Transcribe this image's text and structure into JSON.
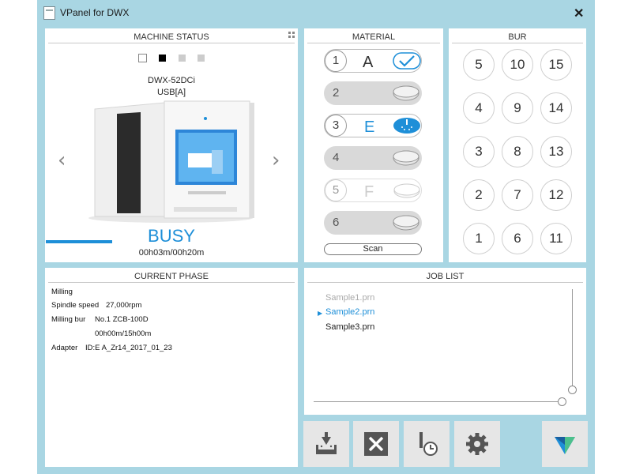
{
  "window": {
    "title": "VPanel for DWX",
    "close_glyph": "✕"
  },
  "machine_status": {
    "title": "MACHINE STATUS",
    "model": "DWX-52DCi",
    "connection": "USB[A]",
    "status": "BUSY",
    "time": "00h03m/00h20m",
    "progress": 0.15,
    "prev_arrow": "‹",
    "next_arrow": "›"
  },
  "material": {
    "title": "MATERIAL",
    "slots": [
      {
        "number": "1",
        "letter": "A",
        "state": "active"
      },
      {
        "number": "2",
        "letter": "",
        "state": "empty"
      },
      {
        "number": "3",
        "letter": "E",
        "state": "in-use"
      },
      {
        "number": "4",
        "letter": "",
        "state": "empty"
      },
      {
        "number": "5",
        "letter": "F",
        "state": "disabled"
      },
      {
        "number": "6",
        "letter": "",
        "state": "empty"
      }
    ],
    "scan_label": "Scan"
  },
  "bur": {
    "title": "BUR",
    "slots": [
      "5",
      "10",
      "15",
      "4",
      "9",
      "14",
      "3",
      "8",
      "13",
      "2",
      "7",
      "12",
      "1",
      "6",
      "11"
    ]
  },
  "current_phase": {
    "title": "CURRENT PHASE",
    "operation": "Milling",
    "spindle_label": "Spindle speed",
    "spindle_value": "27,000rpm",
    "bur_label": "Milling bur",
    "bur_value": "No.1 ZCB-100D",
    "bur_time": "00h00m/15h00m",
    "adapter_label": "Adapter",
    "adapter_value": "ID:E A_Zr14_2017_01_23"
  },
  "job_list": {
    "title": "JOB LIST",
    "jobs": [
      {
        "name": "Sample1.prn",
        "state": "done"
      },
      {
        "name": "Sample2.prn",
        "state": "running"
      },
      {
        "name": "Sample3.prn",
        "state": "queued"
      }
    ]
  },
  "colors": {
    "accent": "#1e8fd8",
    "frame": "#a9d6e3",
    "button_bg": "#e6e6e6"
  },
  "toolbar": {
    "icons": [
      "milling-icon",
      "cancel-icon",
      "bur-timer-icon",
      "settings-icon",
      "logo-icon"
    ]
  }
}
